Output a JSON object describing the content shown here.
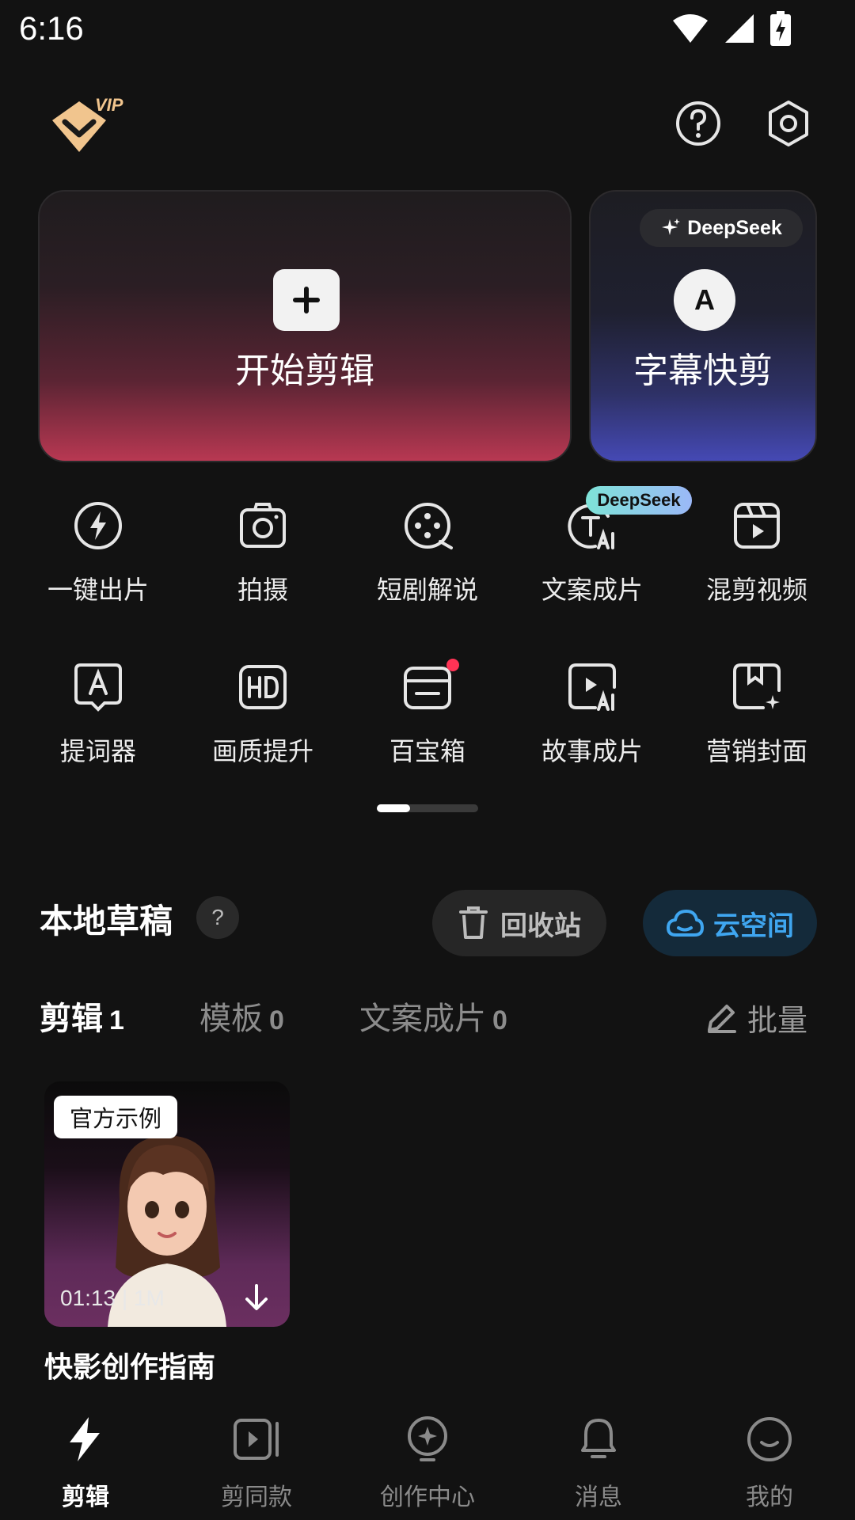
{
  "status_bar": {
    "time": "6:16",
    "icons": [
      "wifi-icon",
      "signal-icon",
      "battery-charging-icon"
    ]
  },
  "header": {
    "vip_badge": "VIP",
    "icons": [
      "help-icon",
      "settings-icon"
    ]
  },
  "cards": {
    "start_edit": {
      "label": "开始剪辑",
      "icon": "plus-icon"
    },
    "subtitle_edit": {
      "badge": "DeepSeek",
      "icon_letter": "A",
      "label": "字幕快剪"
    }
  },
  "tools": [
    {
      "label": "一键出片",
      "icon": "lightning-icon"
    },
    {
      "label": "拍摄",
      "icon": "camera-icon"
    },
    {
      "label": "短剧解说",
      "icon": "film-reel-icon"
    },
    {
      "label": "文案成片",
      "icon": "text-ai-icon",
      "badge": "DeepSeek"
    },
    {
      "label": "混剪视频",
      "icon": "clapper-icon"
    },
    {
      "label": "提词器",
      "icon": "teleprompter-icon"
    },
    {
      "label": "画质提升",
      "icon": "hd-icon"
    },
    {
      "label": "百宝箱",
      "icon": "toolbox-icon",
      "dot": true
    },
    {
      "label": "故事成片",
      "icon": "video-ai-icon"
    },
    {
      "label": "营销封面",
      "icon": "cover-icon"
    }
  ],
  "pager": {
    "current": 1,
    "total": 3
  },
  "drafts": {
    "title": "本地草稿",
    "recycle_label": "回收站",
    "cloud_label": "云空间",
    "tabs": [
      {
        "label": "剪辑",
        "count": "1",
        "active": true
      },
      {
        "label": "模板",
        "count": "0",
        "active": false
      },
      {
        "label": "文案成片",
        "count": "0",
        "active": false
      }
    ],
    "batch_label": "批量",
    "items": [
      {
        "tag": "官方示例",
        "meta": "01:13  |  1M",
        "title": "快影创作指南"
      }
    ]
  },
  "bottom_nav": [
    {
      "label": "剪辑",
      "icon": "lightning-icon",
      "active": true
    },
    {
      "label": "剪同款",
      "icon": "video-template-icon",
      "active": false
    },
    {
      "label": "创作中心",
      "icon": "bulb-icon",
      "active": false
    },
    {
      "label": "消息",
      "icon": "bell-icon",
      "active": false
    },
    {
      "label": "我的",
      "icon": "smile-icon",
      "active": false
    }
  ],
  "colors": {
    "background": "#121212",
    "accent_red": "#b83852",
    "accent_blue": "#4549b4",
    "cloud_blue": "#3fa6f0"
  }
}
